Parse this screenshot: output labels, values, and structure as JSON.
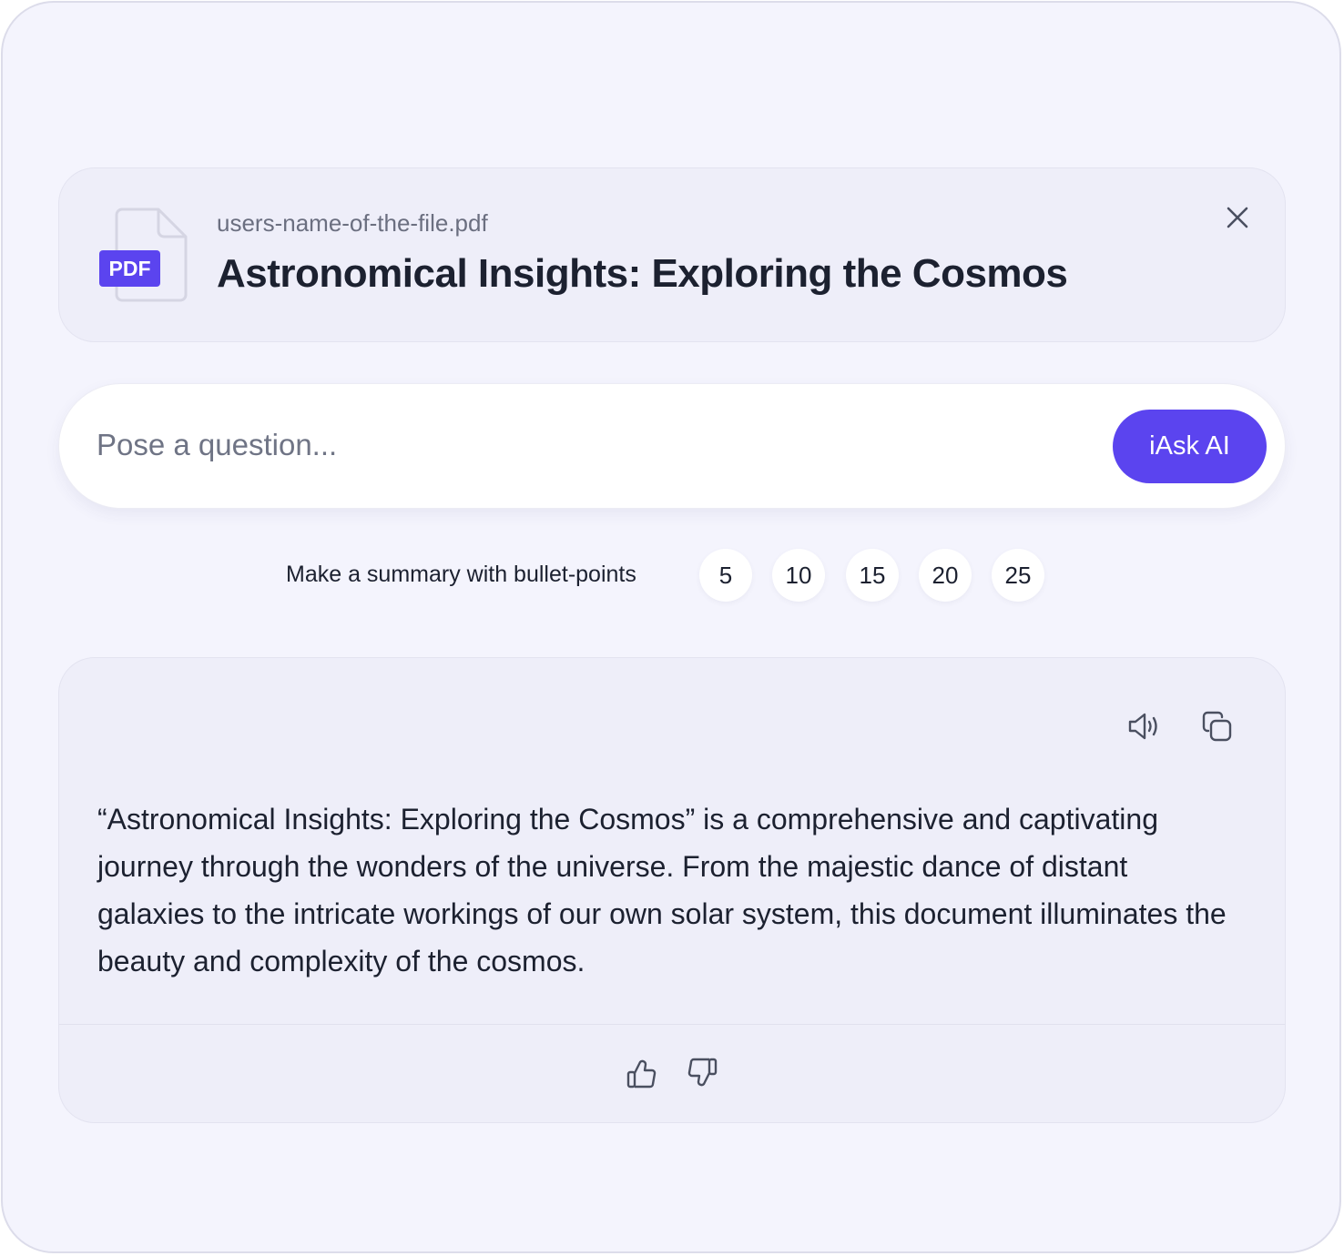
{
  "file": {
    "name": "users-name-of-the-file.pdf",
    "title": "Astronomical Insights: Exploring the Cosmos",
    "badge": "PDF",
    "icon": "pdf-file-icon",
    "close_icon": "close-icon"
  },
  "ask": {
    "placeholder": "Pose a question...",
    "button_label": "iAsk AI"
  },
  "summary": {
    "label": "Make a summary with bullet-points",
    "options": [
      "5",
      "10",
      "15",
      "20",
      "25"
    ]
  },
  "answer": {
    "text": "“Astronomical Insights: Exploring the Cosmos” is a comprehensive and captivating journey through the wonders of the universe. From the majestic dance of distant galaxies to the intricate workings of our own solar system, this document illuminates the beauty and complexity of the cosmos.",
    "actions": [
      "speaker-icon",
      "copy-icon"
    ],
    "feedback": [
      "thumbs-up-icon",
      "thumbs-down-icon"
    ]
  },
  "colors": {
    "accent": "#5b44ef",
    "background": "#f4f4fd",
    "card": "#eeeef9",
    "text": "#1c2130",
    "muted": "#6b6f80"
  }
}
